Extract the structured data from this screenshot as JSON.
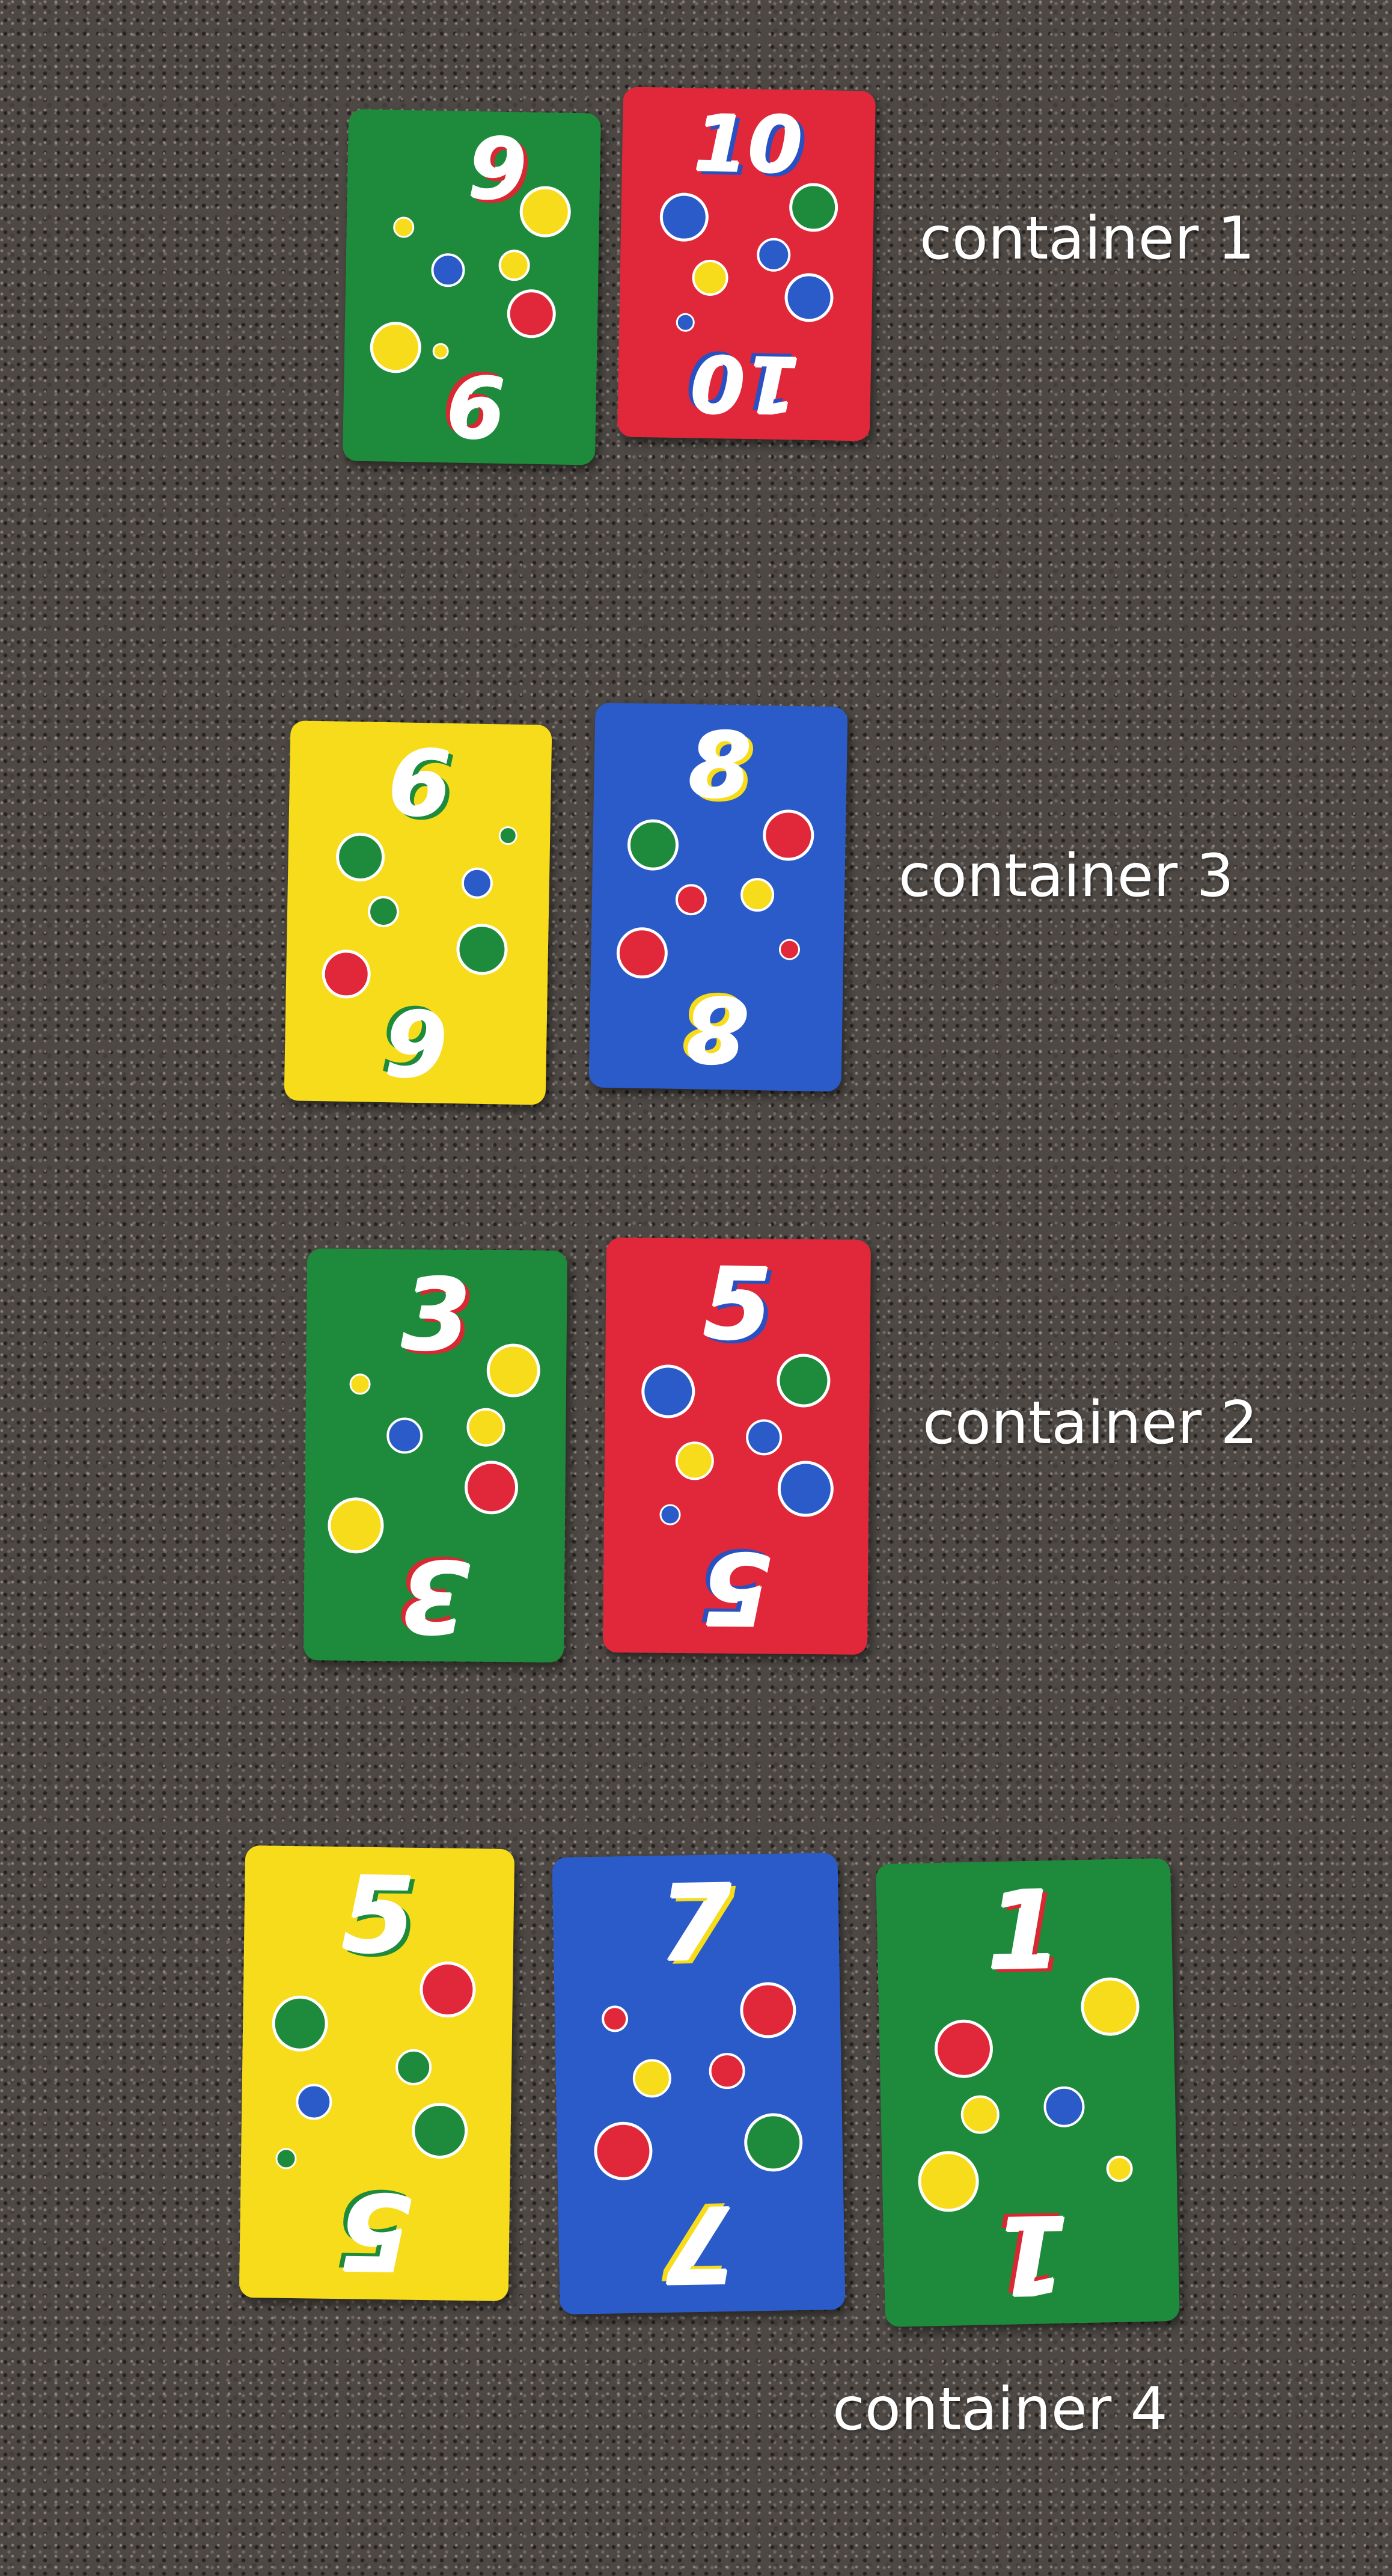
{
  "labels": {
    "container_1": "container 1",
    "container_2": "container 2",
    "container_3": "container 3",
    "container_4": "container 4"
  },
  "cards": [
    {
      "id": "c1a",
      "number": "9",
      "color": "green"
    },
    {
      "id": "c1b",
      "number": "10",
      "color": "red"
    },
    {
      "id": "c3a",
      "number": "6",
      "color": "yellow"
    },
    {
      "id": "c3b",
      "number": "8",
      "color": "blue"
    },
    {
      "id": "c2a",
      "number": "3",
      "color": "green"
    },
    {
      "id": "c2b",
      "number": "5",
      "color": "red"
    },
    {
      "id": "c4a",
      "number": "5",
      "color": "yellow"
    },
    {
      "id": "c4b",
      "number": "7",
      "color": "blue"
    },
    {
      "id": "c4c",
      "number": "1",
      "color": "green"
    }
  ],
  "colors": {
    "green": "#1e8a3c",
    "red": "#e0283a",
    "yellow": "#f6dc1a",
    "blue": "#2a5bc8",
    "carpet": "#4d4844"
  }
}
